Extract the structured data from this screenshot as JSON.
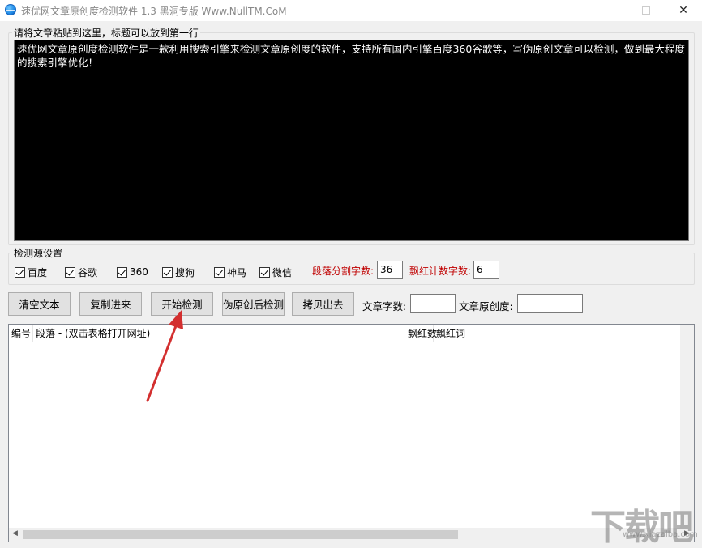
{
  "window": {
    "title": "速优网文章原创度检测软件 1.3    黑洞专版 Www.NullTM.CoM",
    "close_glyph": "✕"
  },
  "content_group": {
    "label": "请将文章粘贴到这里，标题可以放到第一行",
    "text": "速优网文章原创度检测软件是一款利用搜索引擎来检测文章原创度的软件，支持所有国内引擎百度360谷歌等，写伪原创文章可以检测，做到最大程度的搜索引擎优化！"
  },
  "source_group": {
    "label": "检测源设置",
    "checkboxes": [
      {
        "label": "百度",
        "checked": true
      },
      {
        "label": "谷歌",
        "checked": true
      },
      {
        "label": "360",
        "checked": true
      },
      {
        "label": "搜狗",
        "checked": true
      },
      {
        "label": "神马",
        "checked": true
      },
      {
        "label": "微信",
        "checked": true
      }
    ],
    "split_label": "段落分割字数:",
    "split_value": "36",
    "red_count_label": "飘红计数字数:",
    "red_count_value": "6"
  },
  "toolbar": {
    "clear": "清空文本",
    "paste": "复制进来",
    "start": "开始检测",
    "pseudo": "伪原创后检测",
    "copy_out": "拷贝出去",
    "word_count_label": "文章字数:",
    "word_count_value": "",
    "originality_label": "文章原创度:",
    "originality_value": ""
  },
  "table": {
    "columns": [
      "编号",
      "段落 - (双击表格打开网址)",
      "飘红数",
      "飘红词"
    ]
  },
  "colors": {
    "annotation_arrow": "#d32f2f",
    "label_red": "#c00000"
  },
  "watermark": {
    "text": "下载吧",
    "sub": "www.xiazaiba.com"
  }
}
